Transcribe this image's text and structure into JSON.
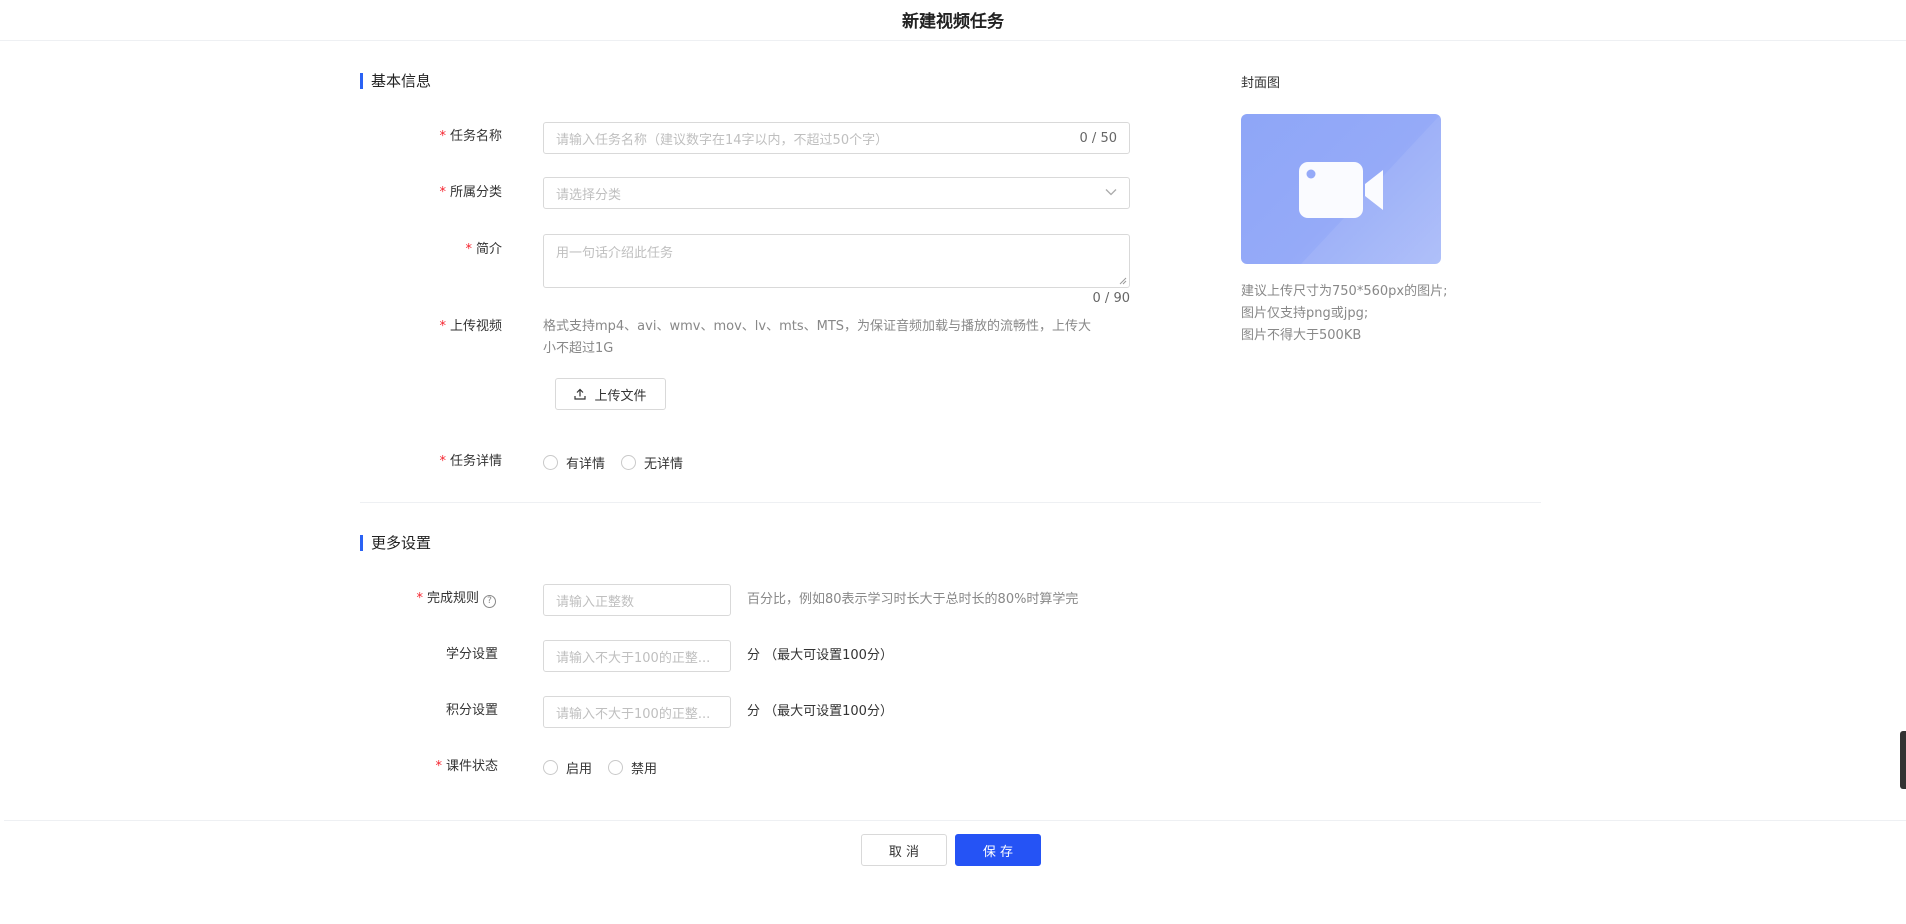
{
  "header": {
    "title": "新建视频任务"
  },
  "basic": {
    "section_title": "基本信息",
    "task_name": {
      "label": "任务名称",
      "placeholder": "请输入任务名称（建议数字在14字以内，不超过50个字）",
      "counter": "0 / 50"
    },
    "category": {
      "label": "所属分类",
      "placeholder": "请选择分类"
    },
    "intro": {
      "label": "简介",
      "placeholder": "用一句话介绍此任务",
      "counter": "0 / 90"
    },
    "upload_video": {
      "label": "上传视频",
      "hint_line1": "格式支持mp4、avi、wmv、mov、lv、mts、MTS，为保证音频加载与播放的流畅性，上传大",
      "hint_line2": "小不超过1G",
      "button_label": "上传文件"
    },
    "task_detail": {
      "label": "任务详情",
      "options": [
        "有详情",
        "无详情"
      ]
    }
  },
  "cover": {
    "label": "封面图",
    "hint_line1": "建议上传尺寸为750*560px的图片;",
    "hint_line2": "图片仅支持png或jpg;",
    "hint_line3": "图片不得大于500KB"
  },
  "more": {
    "section_title": "更多设置",
    "completion_rule": {
      "label": "完成规则",
      "placeholder": "请输入正整数",
      "hint": "百分比，例如80表示学习时长大于总时长的80%时算学完"
    },
    "credit_setting": {
      "label": "学分设置",
      "placeholder": "请输入不大于100的正整...",
      "hint": "分 （最大可设置100分）"
    },
    "points_setting": {
      "label": "积分设置",
      "placeholder": "请输入不大于100的正整...",
      "hint": "分 （最大可设置100分）"
    },
    "course_status": {
      "label": "课件状态",
      "options": [
        "启用",
        "禁用"
      ]
    }
  },
  "footer": {
    "cancel_label": "取 消",
    "save_label": "保 存"
  },
  "colors": {
    "accent": "#2553f5",
    "required": "#f5222d",
    "cover_bg": "#95aaf8"
  }
}
